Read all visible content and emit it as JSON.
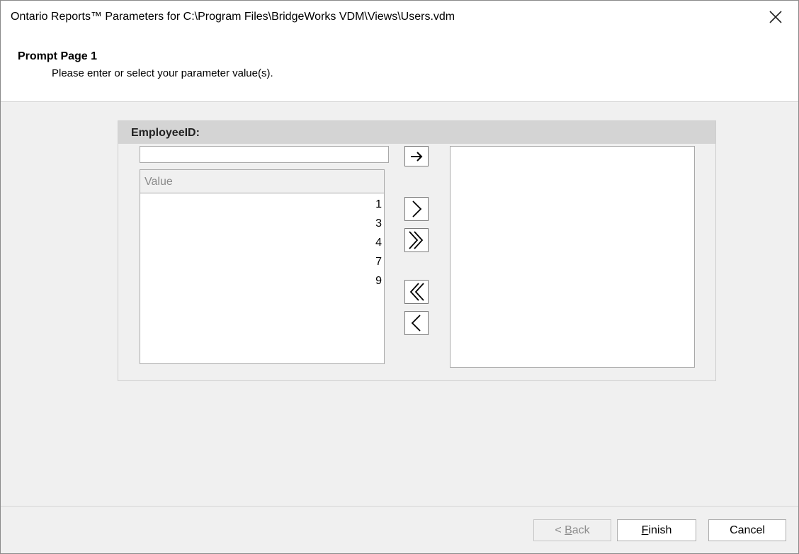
{
  "window": {
    "title": "Ontario Reports™ Parameters for C:\\Program Files\\BridgeWorks VDM\\Views\\Users.vdm",
    "close_icon": "close-icon"
  },
  "header": {
    "title": "Prompt Page 1",
    "subtitle": "Please enter or select your parameter value(s)."
  },
  "parameter": {
    "label": "EmployeeID:",
    "input_value": "",
    "available": {
      "column_header": "Value",
      "items": [
        "1",
        "3",
        "4",
        "7",
        "9"
      ]
    },
    "selected": {
      "items": []
    },
    "buttons": {
      "add_typed": "arrow-right-icon",
      "add_one": "chevron-right-icon",
      "add_all": "double-chevron-right-icon",
      "remove_all": "double-chevron-left-icon",
      "remove_one": "chevron-left-icon"
    }
  },
  "footer": {
    "back": {
      "prefix": "< ",
      "accel": "B",
      "rest": "ack",
      "enabled": false
    },
    "finish": {
      "accel": "F",
      "rest": "inish",
      "enabled": true
    },
    "cancel": {
      "label": "Cancel",
      "enabled": true
    }
  }
}
